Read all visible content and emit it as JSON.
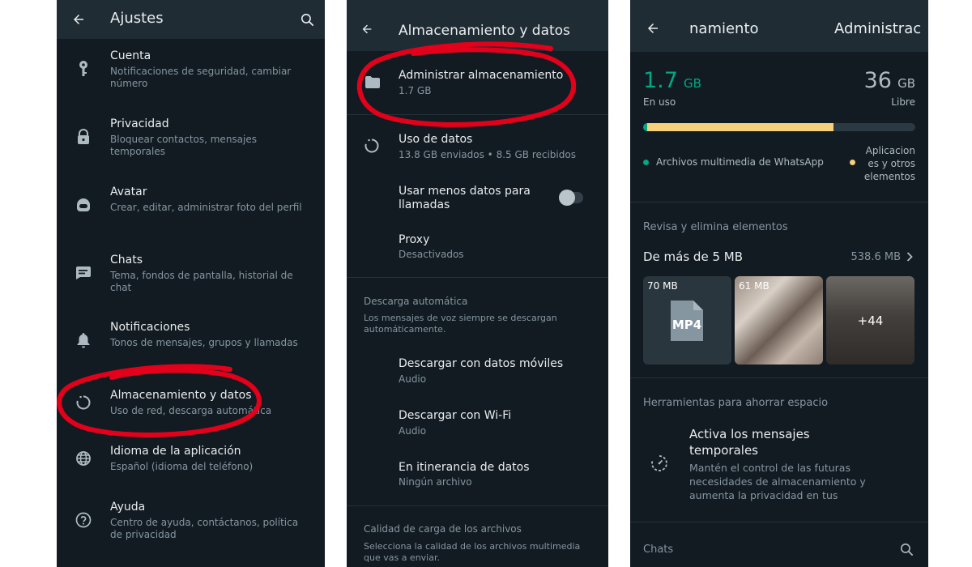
{
  "settings": {
    "title": "Ajustes",
    "items": [
      {
        "label": "Cuenta",
        "desc": "Notificaciones de seguridad, cambiar número",
        "icon": "key-icon"
      },
      {
        "label": "Privacidad",
        "desc": "Bloquear contactos, mensajes temporales",
        "icon": "lock-icon"
      },
      {
        "label": "Avatar",
        "desc": "Crear, editar, administrar foto del perfil",
        "icon": "avatar-icon"
      },
      {
        "label": "Chats",
        "desc": "Tema, fondos de pantalla, historial de chat",
        "icon": "chat-icon"
      },
      {
        "label": "Notificaciones",
        "desc": "Tonos de mensajes, grupos y llamadas",
        "icon": "bell-icon"
      },
      {
        "label": "Almacenamiento y datos",
        "desc": "Uso de red, descarga automática",
        "icon": "data-circle-icon"
      },
      {
        "label": "Idioma de la aplicación",
        "desc": "Español (idioma del teléfono)",
        "icon": "globe-icon"
      },
      {
        "label": "Ayuda",
        "desc": "Centro de ayuda, contáctanos, política de privacidad",
        "icon": "help-icon"
      }
    ]
  },
  "storage": {
    "title": "Almacenamiento y datos",
    "manage": {
      "label": "Administrar almacenamiento",
      "value": "1.7 GB"
    },
    "usage": {
      "label": "Uso de datos",
      "value": "13.8 GB enviados • 8.5 GB recibidos"
    },
    "less_data": {
      "label": "Usar menos datos para llamadas",
      "enabled": false
    },
    "proxy": {
      "label": "Proxy",
      "value": "Desactivados"
    },
    "autodownload": {
      "header": "Descarga automática",
      "note": "Los mensajes de voz siempre se descargan automáticamente.",
      "items": [
        {
          "label": "Descargar con datos móviles",
          "value": "Audio"
        },
        {
          "label": "Descargar con Wi-Fi",
          "value": "Audio"
        },
        {
          "label": "En itinerancia de datos",
          "value": "Ningún archivo"
        }
      ]
    },
    "quality": {
      "header": "Calidad de carga de los archivos",
      "note": "Selecciona la calidad de los archivos multimedia que vas a enviar."
    }
  },
  "manage": {
    "title_left": "namiento",
    "title_right": "Administrac",
    "used": {
      "value": "1.7",
      "unit": "GB",
      "label": "En uso"
    },
    "free": {
      "value": "36",
      "unit": "GB",
      "label": "Libre"
    },
    "usage_fill": {
      "whatsapp_fraction": 0.015,
      "apps_fraction": 0.685
    },
    "legend": [
      {
        "label": "Archivos multimedia de WhatsApp",
        "color": "#00a884"
      },
      {
        "label": "Aplicaciones y otros elementos",
        "color": "#f7d07b"
      }
    ],
    "review_header": "Revisa y elimina elementos",
    "large_files": {
      "label": "De más de 5 MB",
      "size": "538.6 MB"
    },
    "thumbs": [
      {
        "size": "70 MB",
        "badge": "MP4"
      },
      {
        "size": "61 MB"
      },
      {
        "overlay": "+44"
      }
    ],
    "tools_header": "Herramientas para ahorrar espacio",
    "tool": {
      "title": "Activa los mensajes temporales",
      "desc": "Mantén el control de las futuras necesidades de almacenamiento y aumenta la privacidad en tus"
    },
    "chats_label": "Chats"
  },
  "colors": {
    "background": "#121b22",
    "header": "#1f2c34",
    "accent": "#00a884",
    "highlight": "#e3001b"
  }
}
